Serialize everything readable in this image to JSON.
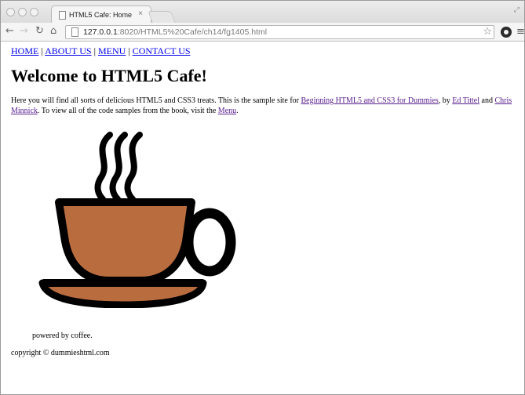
{
  "browser": {
    "tab_title": "HTML5 Cafe: Home",
    "tab_close": "×",
    "url_host": "127.0.0.1",
    "url_path": ":8020/HTML5%20Cafe/ch14/fg1405.html",
    "icons": [
      "back-arrow-icon",
      "forward-arrow-icon",
      "reload-icon",
      "home-icon",
      "page-icon",
      "star-icon",
      "extension-icon",
      "menu-icon"
    ]
  },
  "nav": {
    "items": [
      "HOME",
      "ABOUT US",
      "MENU",
      "CONTACT US"
    ],
    "separator": "|"
  },
  "page": {
    "heading": "Welcome to HTML5 Cafe!",
    "intro_1": "Here you will find all sorts of delicious HTML5 and CSS3 treats. This is the sample site for ",
    "link_book": "Beginning HTML5 and CSS3 for Dummies",
    "intro_2": ", by ",
    "link_author1": "Ed Tittel",
    "intro_3": " and ",
    "link_author2": "Chris Minnick",
    "intro_4": ". To view all of the code samples from the book, visit the ",
    "link_menu": "Menu",
    "intro_5": ".",
    "caption": "powered by coffee.",
    "copyright": "copyright © dummieshtml.com"
  },
  "colors": {
    "coffee": "#b96c3e",
    "outline": "#000000",
    "link": "#0000ee",
    "visited_link": "#551a8b"
  }
}
